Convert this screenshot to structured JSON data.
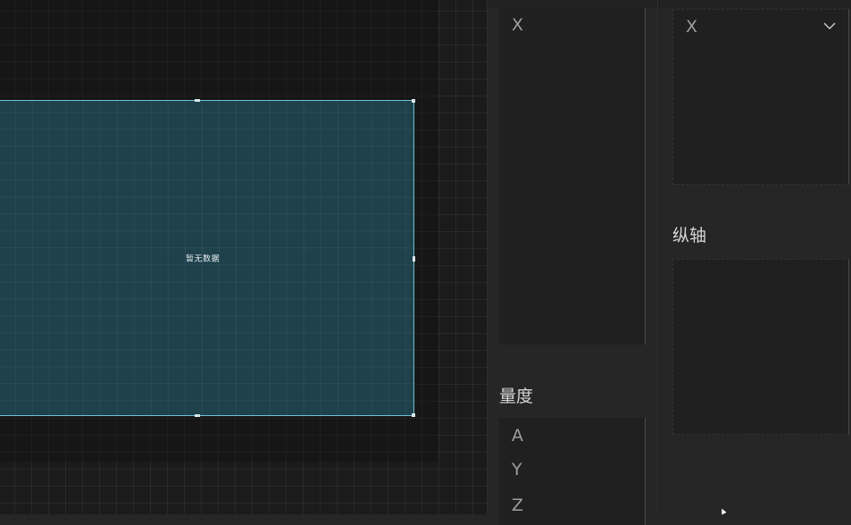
{
  "canvas": {
    "chart_widget": {
      "empty_message": "暂无数据"
    }
  },
  "field_panel": {
    "dimension_items": [
      "X"
    ],
    "measure_label": "量度",
    "measure_items": [
      "A",
      "Y",
      "Z"
    ]
  },
  "axis_panel": {
    "x_axis": {
      "selected_field": "X",
      "dropdown_icon": "chevron-down-icon"
    },
    "y_axis_label": "纵轴",
    "y_axis_items": []
  },
  "colors": {
    "canvas_bg": "#1b1b1b",
    "widget_fill": "#214e5c",
    "widget_border": "#6fc3d6",
    "panel_bg": "#262626",
    "dropzone_bg": "#202020",
    "text_muted": "#9e9e9e",
    "text_label": "#d6d6d6"
  }
}
